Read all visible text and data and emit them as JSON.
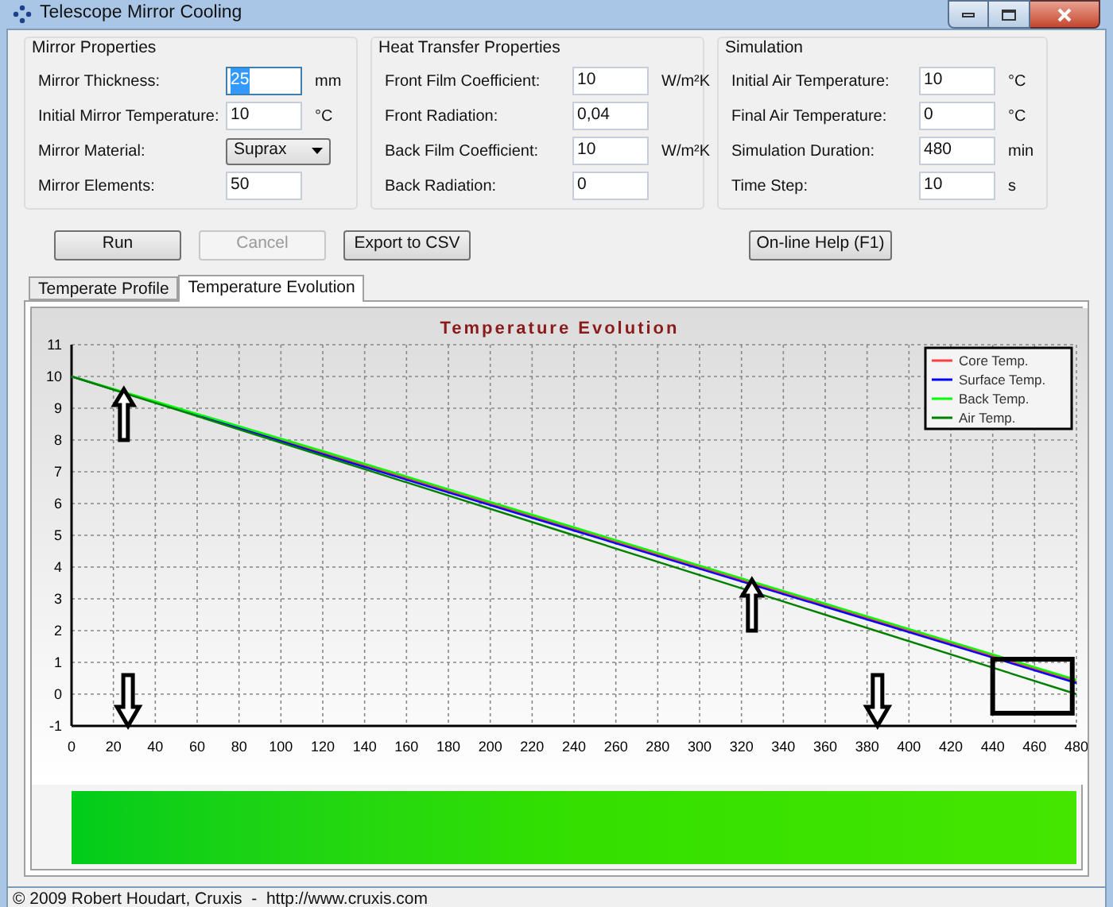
{
  "window": {
    "title": "Telescope Mirror Cooling"
  },
  "groups": [
    {
      "title": "Mirror Properties",
      "fields": [
        {
          "kind": "input",
          "label": "Mirror Thickness:",
          "value": "25",
          "unit": "mm",
          "selected": true
        },
        {
          "kind": "input",
          "label": "Initial Mirror Temperature:",
          "value": "10",
          "unit": "°C",
          "selected": false
        },
        {
          "kind": "select",
          "label": "Mirror Material:",
          "value": "Suprax",
          "selected": false
        },
        {
          "kind": "input",
          "label": "Mirror Elements:",
          "value": "50",
          "selected": false
        }
      ]
    },
    {
      "title": "Heat Transfer Properties",
      "fields": [
        {
          "kind": "input",
          "label": "Front Film Coefficient:",
          "value": "10",
          "unit": "W/m²K",
          "selected": false
        },
        {
          "kind": "input",
          "label": "Front Radiation:",
          "value": "0,04",
          "selected": false
        },
        {
          "kind": "input",
          "label": "Back Film Coefficient:",
          "value": "10",
          "unit": "W/m²K",
          "selected": false
        },
        {
          "kind": "input",
          "label": "Back Radiation:",
          "value": "0",
          "selected": false
        }
      ]
    },
    {
      "title": "Simulation",
      "fields": [
        {
          "kind": "input",
          "label": "Initial Air Temperature:",
          "value": "10",
          "unit": "°C",
          "selected": false
        },
        {
          "kind": "input",
          "label": "Final Air Temperature:",
          "value": "0",
          "unit": "°C",
          "selected": false
        },
        {
          "kind": "input",
          "label": "Simulation Duration:",
          "value": "480",
          "unit": "min",
          "selected": false
        },
        {
          "kind": "input",
          "label": "Time Step:",
          "value": "10",
          "unit": "s",
          "selected": false
        }
      ]
    }
  ],
  "buttons": [
    {
      "label": "Run",
      "disabled": false
    },
    {
      "label": "Cancel",
      "disabled": true
    },
    {
      "label": "Export to CSV",
      "disabled": false
    }
  ],
  "help_button": {
    "label": "On-line Help (F1)"
  },
  "tabs": [
    {
      "label": "Temperate Profile",
      "selected": false
    },
    {
      "label": "Temperature Evolution",
      "selected": true
    }
  ],
  "chart": {
    "chart_data": {
      "type": "line",
      "title": "Temperature Evolution",
      "x": [
        0,
        120,
        240,
        360,
        480
      ],
      "series": [
        {
          "name": "Core Temp.",
          "color": "#ff4040",
          "values": [
            10,
            7.6,
            5.2,
            2.8,
            0.4
          ]
        },
        {
          "name": "Surface Temp.",
          "color": "#0000ff",
          "values": [
            10,
            7.55,
            5.15,
            2.75,
            0.35
          ]
        },
        {
          "name": "Back Temp.",
          "color": "#00ff00",
          "values": [
            10,
            7.65,
            5.25,
            2.85,
            0.45
          ]
        },
        {
          "name": "Air Temp.",
          "color": "#008000",
          "values": [
            10,
            7.5,
            5,
            2.5,
            0
          ]
        }
      ],
      "xlim": [
        0,
        480
      ],
      "ylim": [
        -1,
        11
      ],
      "grid": true,
      "legend": true,
      "xticks": [
        0,
        20,
        40,
        60,
        80,
        100,
        120,
        140,
        160,
        180,
        200,
        220,
        240,
        260,
        280,
        300,
        320,
        340,
        360,
        380,
        400,
        420,
        440,
        460,
        480
      ],
      "yticks": [
        -1,
        0,
        1,
        2,
        3,
        4,
        5,
        6,
        7,
        8,
        9,
        10,
        11
      ]
    }
  },
  "status_bar": {
    "text": "© 2009 Robert Houdart, Cruxis  -  http://www.cruxis.com"
  }
}
